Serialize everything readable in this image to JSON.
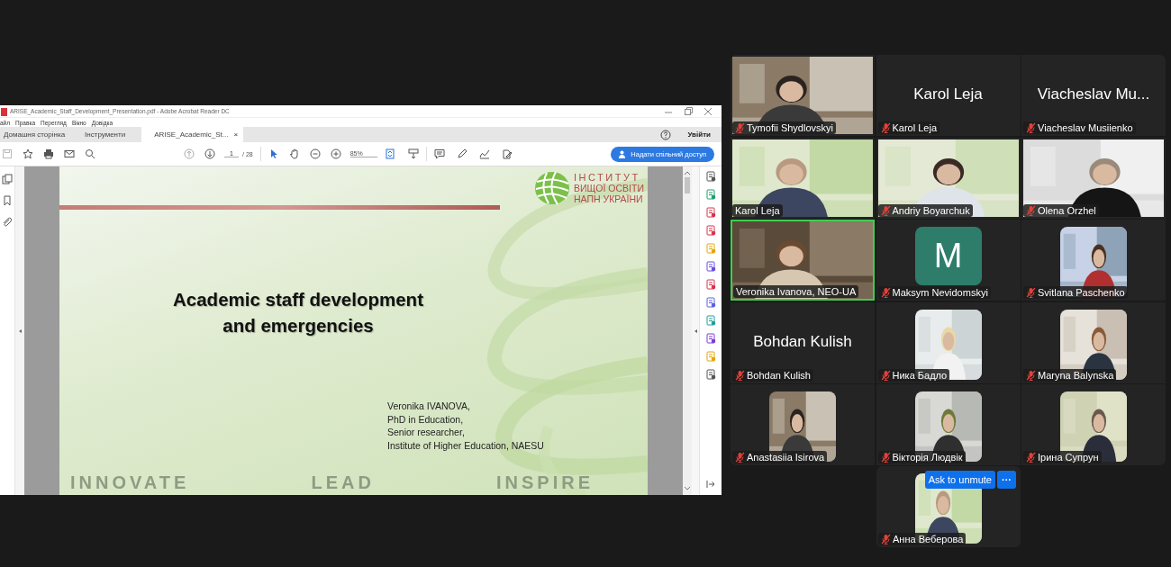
{
  "shared_screen": {
    "window": {
      "title": "ARISE_Academic_Staff_Development_Presentation.pdf - Adobe Acrobat Reader DC",
      "menu": [
        "айл",
        "Правка",
        "Перегляд",
        "Вікно",
        "Довідка"
      ],
      "tabs": [
        {
          "label": "Домашня сторінка",
          "selected": false
        },
        {
          "label": "Інструменти",
          "selected": false
        },
        {
          "label": "ARISE_Academic_St...",
          "selected": true,
          "close": "×"
        }
      ],
      "sign_in": "Увійти",
      "toolbar": {
        "page": "1",
        "page_total": "/ 28",
        "zoom": "85%",
        "share_button": "Надати спільний доступ"
      },
      "slide": {
        "logo_lines": [
          "ІНСТИТУТ",
          "ВИЩОЇ ОСВІТИ",
          "НАПН УКРАЇНИ"
        ],
        "title": "Academic staff development and emergencies",
        "author_lines": [
          "Veronika IVANOVA,",
          "PhD in Education,",
          "Senior researcher,",
          "Institute of Higher Education, NAESU"
        ],
        "footer": [
          "INNOVATE",
          "LEAD",
          "INSPIRE"
        ]
      }
    }
  },
  "participants": [
    {
      "kind": "video",
      "name": "Tymofii Shydlovskyi",
      "muted": true,
      "speaking": false
    },
    {
      "kind": "name",
      "display_name": "Karol Leja",
      "name": "Karol Leja",
      "muted": true,
      "speaking": false
    },
    {
      "kind": "name",
      "display_name": "Viacheslav Mu...",
      "name": "Viacheslav Musiienko",
      "muted": true,
      "speaking": false
    },
    {
      "kind": "video",
      "name": "Karol Leja",
      "muted": false,
      "speaking": false
    },
    {
      "kind": "video",
      "name": "Andriy Boyarchuk",
      "muted": true,
      "speaking": false
    },
    {
      "kind": "video",
      "name": "Olena Orzhel",
      "muted": true,
      "speaking": false
    },
    {
      "kind": "video",
      "name": "Veronika Ivanova, NEO-UA",
      "muted": false,
      "speaking": true
    },
    {
      "kind": "letter",
      "initial": "M",
      "name": "Maksym Nevidomskyi",
      "muted": true,
      "speaking": false
    },
    {
      "kind": "avatar",
      "name": "Svitlana Paschenko",
      "muted": true,
      "speaking": false
    },
    {
      "kind": "name",
      "display_name": "Bohdan Kulish",
      "name": "Bohdan Kulish",
      "muted": true,
      "speaking": false
    },
    {
      "kind": "avatar",
      "name": "Ника Бадло",
      "muted": true,
      "speaking": false
    },
    {
      "kind": "avatar",
      "name": "Maryna Balynska",
      "muted": true,
      "speaking": false
    },
    {
      "kind": "avatar",
      "name": "Anastasiia Isirova",
      "muted": true,
      "speaking": false
    },
    {
      "kind": "avatar",
      "name": "Вікторія Людвік",
      "muted": true,
      "speaking": false
    },
    {
      "kind": "avatar",
      "name": "Ірина Супрун",
      "muted": true,
      "speaking": false
    }
  ],
  "hovered_participant": {
    "kind": "avatar",
    "name": "Анна Веберова",
    "muted": true,
    "speaking": false,
    "ask_button": "Ask to unmute",
    "more_button": "···"
  }
}
